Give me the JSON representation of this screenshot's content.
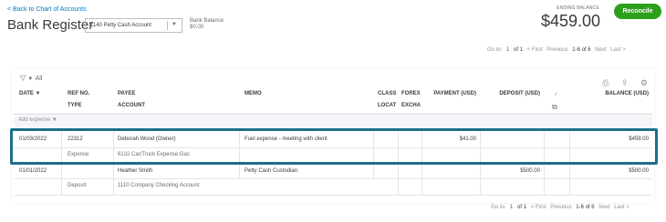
{
  "header": {
    "back_link": "< Back to Chart of Accounts",
    "title": "Bank Register",
    "account_selected": "1140 Petty Cash Account",
    "bank_balance_label": "Bank Balance",
    "bank_balance_value": "$0.00",
    "ending_balance_label": "ENDING BALANCE",
    "ending_balance_value": "$459.00",
    "reconcile_label": "Reconcile"
  },
  "pager": {
    "goto": "Go to:",
    "page": "1",
    "of": "of 1",
    "first": "< First",
    "previous": "Previous",
    "range": "1-6 of 6",
    "next": "Next",
    "last": "Last >"
  },
  "filter": {
    "label": "All"
  },
  "columns": {
    "date": "DATE ▼",
    "ref": "REF NO.",
    "type": "TYPE",
    "payee": "PAYEE",
    "account": "ACCOUNT",
    "memo": "MEMO",
    "class": "CLASS",
    "locat": "LOCAT",
    "forex": "FOREX",
    "excha": "EXCHA",
    "payment": "PAYMENT (USD)",
    "deposit": "DEPOSIT (USD)",
    "balance": "BALANCE (USD)"
  },
  "add_expense": "Add expense ▼",
  "rows": [
    {
      "date": "01/03/2022",
      "ref": "22312",
      "type": "Expense",
      "payee": "Deborah Wood (Owner)",
      "account": "6132 Car/Truck Expense:Gas",
      "memo": "Fuel expense - meeting with client",
      "payment": "$41.00",
      "deposit": "",
      "balance": "$459.00"
    },
    {
      "date": "01/01/2022",
      "ref": "",
      "type": "Deposit",
      "payee": "Heather Smith",
      "account": "1110 Company Checking Account",
      "memo": "Petty Cash Custodian",
      "payment": "",
      "deposit": "$500.00",
      "balance": "$500.00"
    }
  ],
  "icons": {
    "filter": "filter-icon",
    "print": "print-icon",
    "export": "export-icon",
    "settings": "gear-icon",
    "attachment": "attachment-icon",
    "check": "reconcile-check-icon"
  },
  "colors": {
    "accent": "#0077c5",
    "reconcile": "#2ca01c",
    "highlight": "#1d6e8c"
  }
}
